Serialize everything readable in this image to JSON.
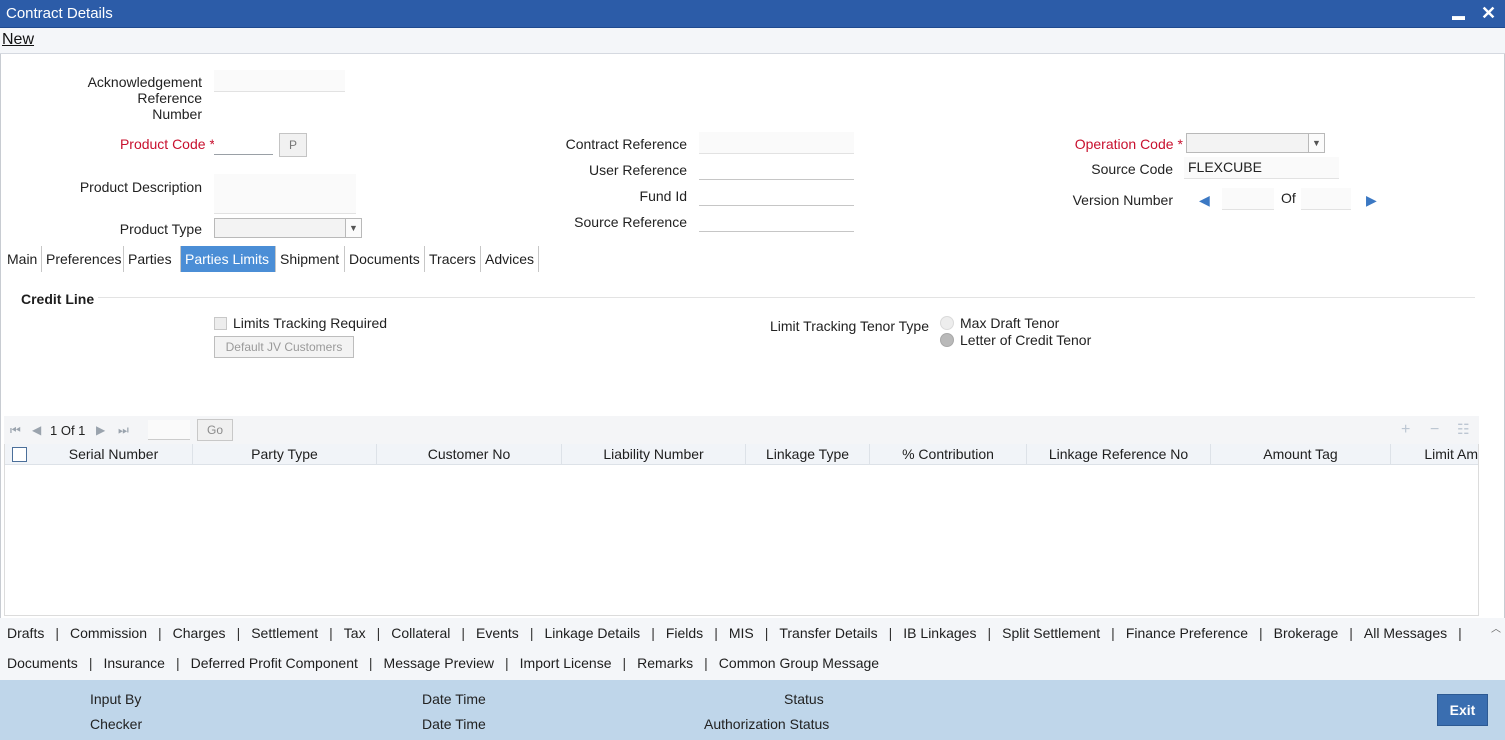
{
  "window": {
    "title": "Contract Details",
    "minimize_glyph": "▬",
    "close_glyph": "✕"
  },
  "menu": {
    "new_label": "New"
  },
  "header": {
    "ack_ref_label_line1": "Acknowledgement Reference",
    "ack_ref_label_line2": "Number",
    "ack_ref_value": "",
    "product_code_label": "Product Code",
    "required_mark": "*",
    "product_code_value": "",
    "product_button": "P",
    "product_desc_label": "Product Description",
    "product_type_label": "Product Type",
    "contract_ref_label": "Contract Reference",
    "user_ref_label": "User Reference",
    "fund_id_label": "Fund Id",
    "source_ref_label": "Source Reference",
    "operation_code_label": "Operation Code",
    "source_code_label": "Source Code",
    "source_code_value": "FLEXCUBE",
    "version_number_label": "Version Number",
    "version_of": "Of"
  },
  "tabs": [
    "Main",
    "Preferences",
    "Parties",
    "Parties Limits",
    "Shipment",
    "Documents",
    "Tracers",
    "Advices"
  ],
  "active_tab": "Parties Limits",
  "credit_line": {
    "title": "Credit Line",
    "limits_tracking_label": "Limits Tracking Required",
    "default_jv_button": "Default JV Customers",
    "tenor_type_label": "Limit Tracking Tenor Type",
    "tenor_options": [
      "Max Draft Tenor",
      "Letter of Credit Tenor"
    ],
    "tenor_selected": "Letter of Credit Tenor"
  },
  "grid": {
    "pager_text": "1 Of 1",
    "go_label": "Go",
    "columns": [
      "Serial Number",
      "Party Type",
      "Customer No",
      "Liability Number",
      "Linkage Type",
      "% Contribution",
      "Linkage Reference No",
      "Amount Tag",
      "Limit Am"
    ],
    "rows": []
  },
  "bottom_links": {
    "row1": [
      "Drafts",
      "Commission",
      "Charges",
      "Settlement",
      "Tax",
      "Collateral",
      "Events",
      "Linkage Details",
      "Fields",
      "MIS",
      "Transfer Details",
      "IB Linkages",
      "Split Settlement",
      "Finance Preference",
      "Brokerage",
      "All Messages"
    ],
    "row2": [
      "Documents",
      "Insurance",
      "Deferred Profit Component",
      "Message Preview",
      "Import License",
      "Remarks",
      "Common Group Message"
    ]
  },
  "footer": {
    "input_by": "Input By",
    "checker": "Checker",
    "date_time_1": "Date Time",
    "date_time_2": "Date Time",
    "status": "Status",
    "authorization_status": "Authorization Status",
    "exit_label": "Exit"
  },
  "colors": {
    "titlebar": "#2c5ca8",
    "active_tab": "#4b8ed6",
    "footer": "#bfd6ea",
    "required": "#c8102e",
    "exit_button": "#3a6eb0"
  }
}
